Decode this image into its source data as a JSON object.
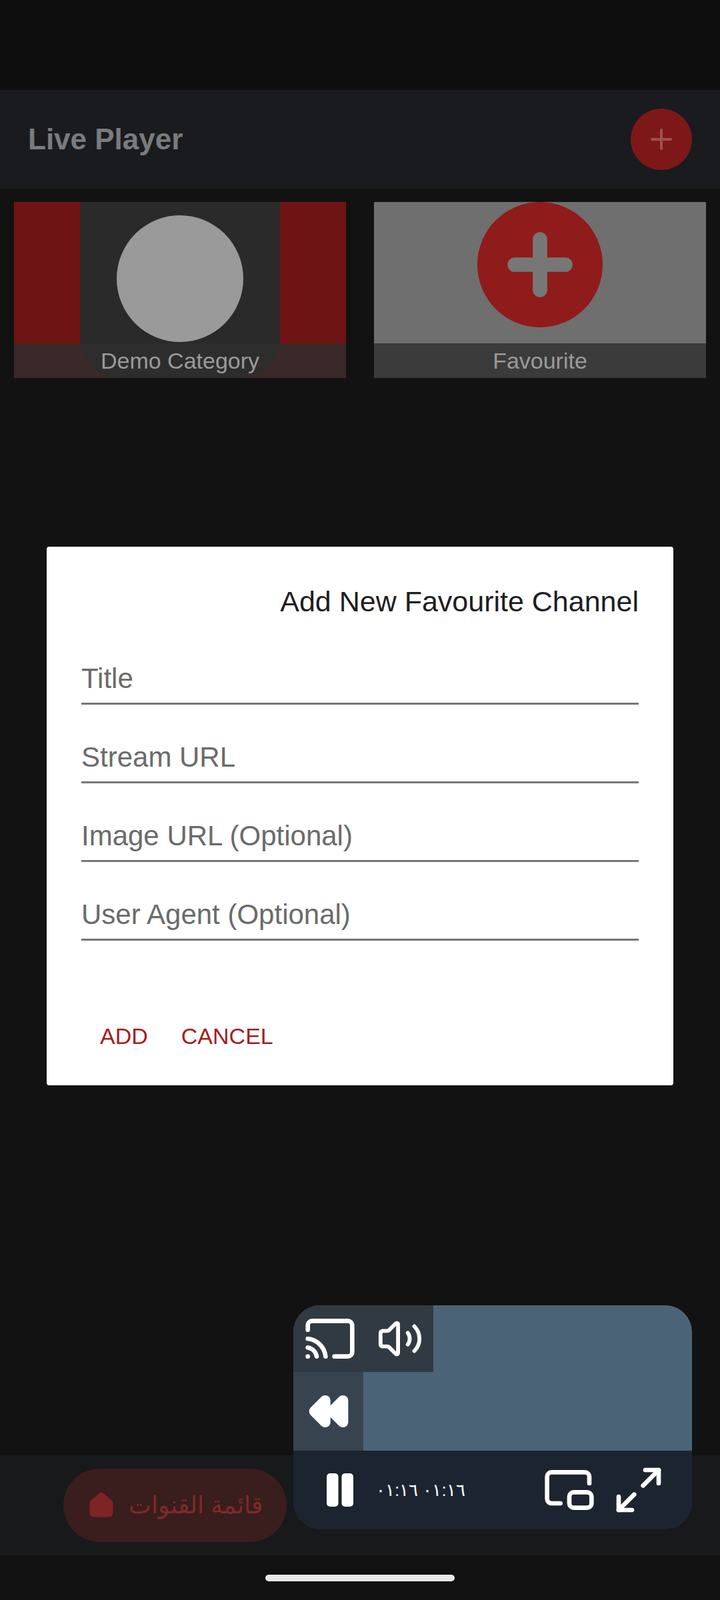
{
  "app_bar": {
    "title": "Live Player"
  },
  "categories": [
    {
      "label": "Demo Category",
      "kind": "image"
    },
    {
      "label": "Favourite",
      "kind": "add"
    }
  ],
  "dialog": {
    "title": "Add New Favourite Channel",
    "fields": [
      {
        "placeholder": "Title"
      },
      {
        "placeholder": "Stream URL"
      },
      {
        "placeholder": "Image URL (Optional)"
      },
      {
        "placeholder": "User Agent (Optional)"
      }
    ],
    "buttons": [
      "ADD",
      "CANCEL"
    ]
  },
  "bottom_nav": {
    "label": "قائمة القنوات"
  },
  "mini_player": {
    "playing": true,
    "time": "٠١:١٦ ٠١:١٦"
  }
}
